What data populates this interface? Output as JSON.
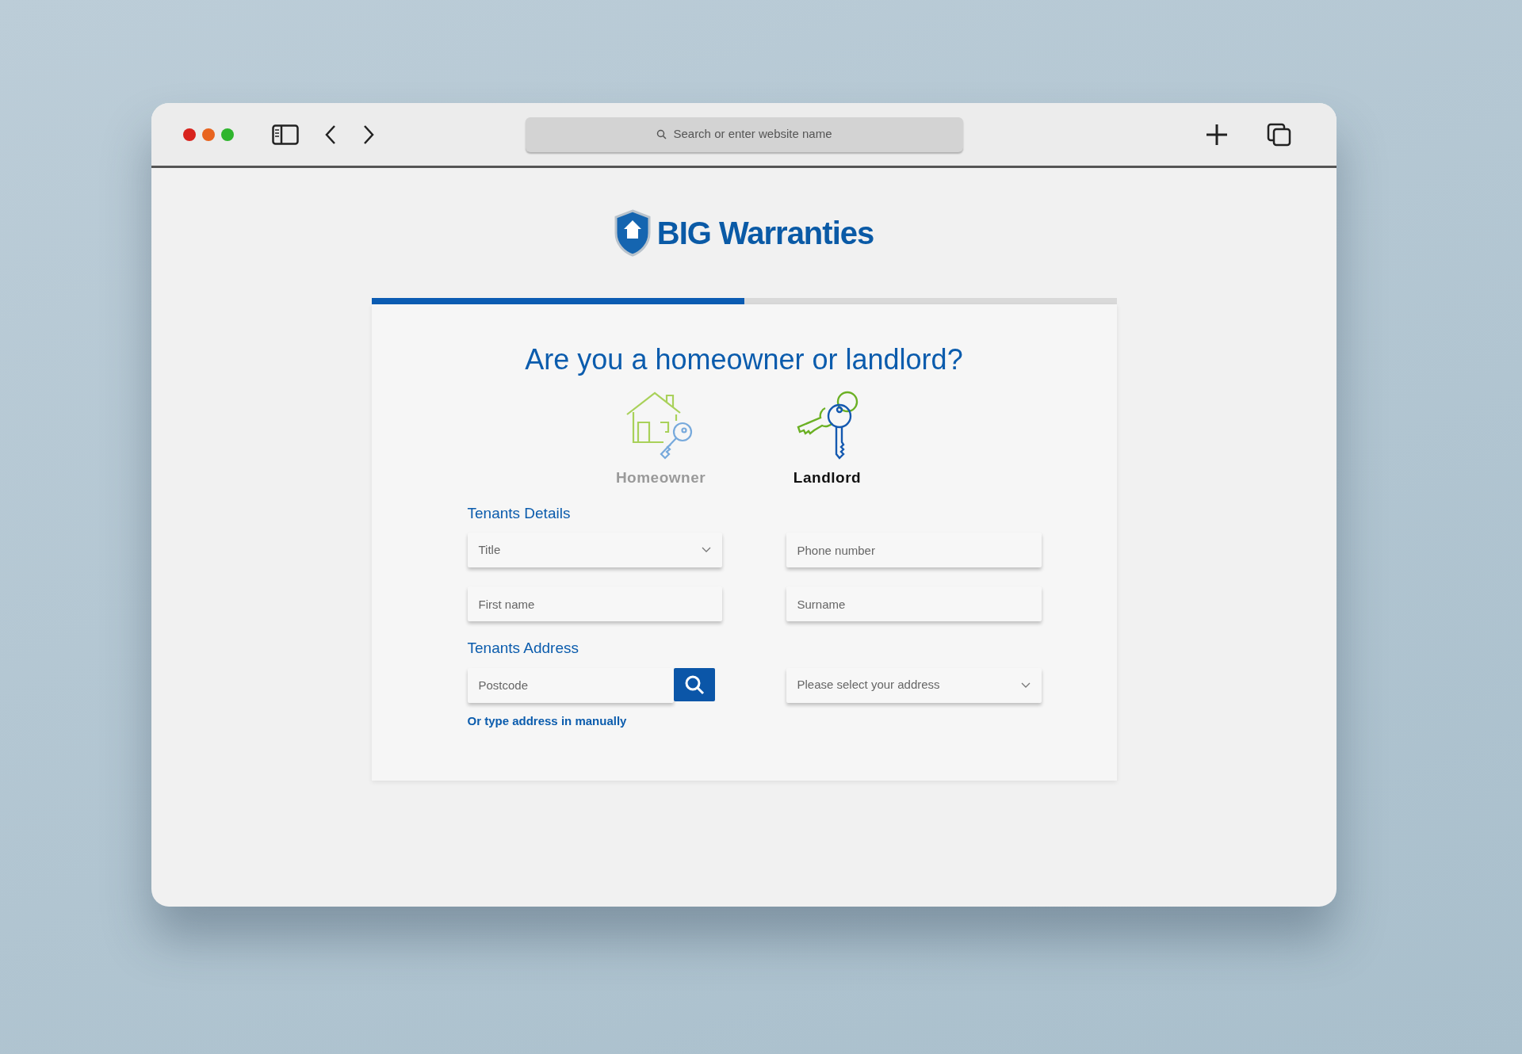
{
  "browser": {
    "address_placeholder": "Search or enter website name"
  },
  "logo": {
    "text": "BIG Warranties"
  },
  "progress": {
    "level": 0.5
  },
  "heading": "Are you a homeowner or landlord?",
  "account_types": [
    {
      "kind": "house",
      "label": "Homeowner",
      "selected": false
    },
    {
      "kind": "keys",
      "label": "Landlord",
      "selected": true
    }
  ],
  "sections": [
    {
      "title": "Tenants Details",
      "fields": [
        {
          "kind": "select",
          "placeholder": "Title"
        },
        {
          "kind": "text",
          "placeholder": "Phone number"
        },
        {
          "kind": "text",
          "placeholder": "First name"
        },
        {
          "kind": "text",
          "placeholder": "Surname"
        }
      ]
    },
    {
      "title": "Tenants Address",
      "fields": [
        {
          "kind": "search",
          "placeholder": "Postcode"
        },
        {
          "kind": "select",
          "placeholder": "Please select your address"
        }
      ],
      "link": "Or type address in manually"
    }
  ]
}
